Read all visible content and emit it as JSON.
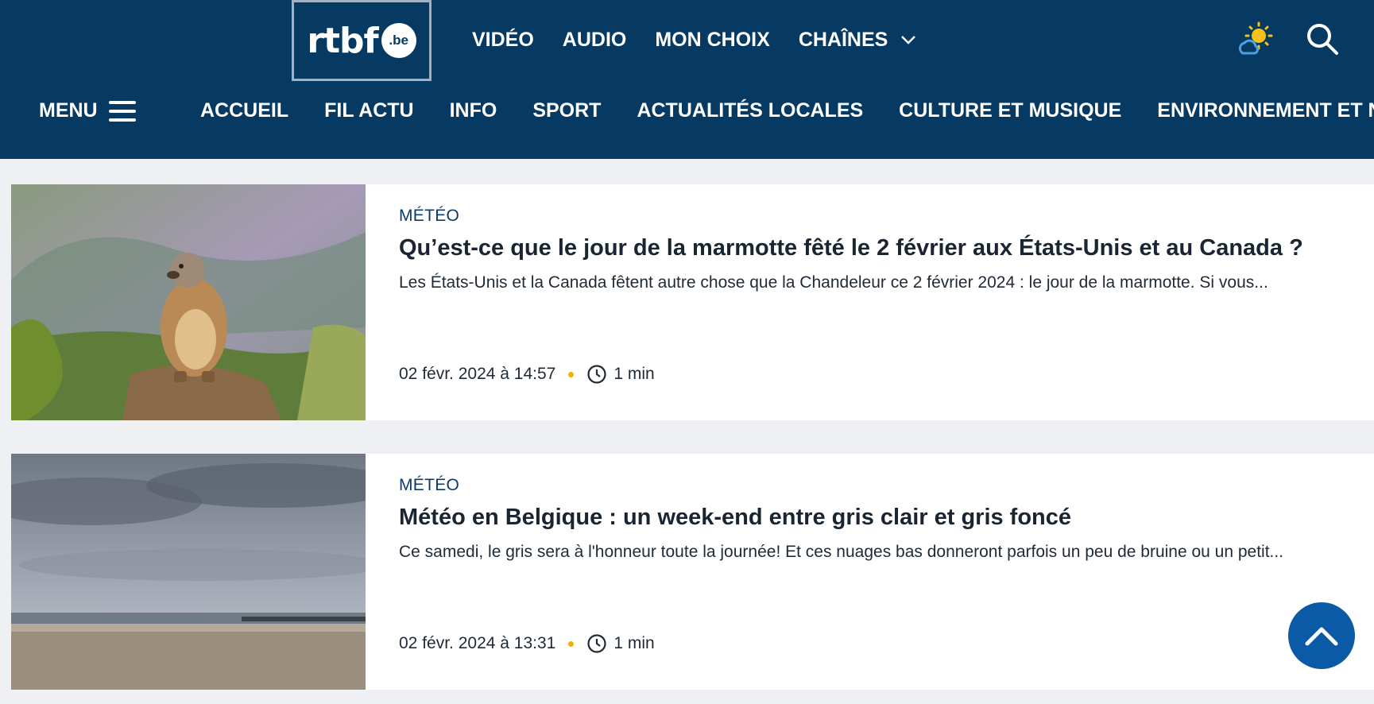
{
  "header": {
    "logo_text": "rtbf",
    "logo_badge": ".be",
    "top_nav": [
      "VIDÉO",
      "AUDIO",
      "MON CHOIX",
      "CHAÎNES"
    ],
    "menu_label": "MENU",
    "sections": [
      "ACCUEIL",
      "FIL ACTU",
      "INFO",
      "SPORT",
      "ACTUALITÉS LOCALES",
      "CULTURE ET MUSIQUE",
      "ENVIRONNEMENT ET N..."
    ],
    "icons": {
      "weather": "weather-sun-cloud-icon",
      "search": "search-icon",
      "chevron": "chevron-down-icon",
      "menu": "hamburger-icon"
    }
  },
  "articles": [
    {
      "category": "MÉTÉO",
      "title": "Qu’est-ce que le jour de la marmotte fêté le 2 février aux États-Unis et au Canada ?",
      "description": "Les États-Unis et la Canada fêtent autre chose que la Chandeleur ce 2 février 2024 : le jour de la marmotte. Si vous...",
      "date": "02 févr. 2024 à 14:57",
      "duration": "1 min"
    },
    {
      "category": "MÉTÉO",
      "title": "Météo en Belgique : un week-end entre gris clair et gris foncé",
      "description": "Ce samedi, le gris sera à l'honneur toute la journée! Et ces nuages bas donneront parfois un peu de bruine ou un petit...",
      "date": "02 févr. 2024 à 13:31",
      "duration": "1 min"
    }
  ],
  "colors": {
    "header_bg": "#073a62",
    "accent_dot": "#f2b200",
    "scroll_button": "#0a5aa6"
  }
}
